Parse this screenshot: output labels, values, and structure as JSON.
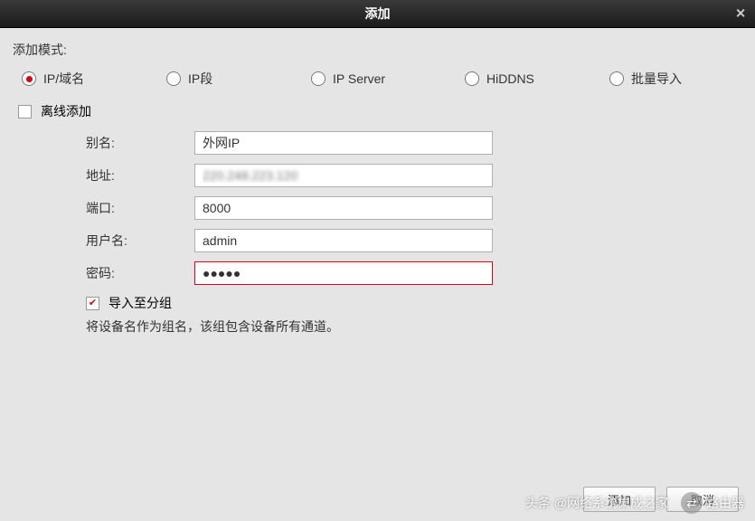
{
  "window": {
    "title": "添加"
  },
  "mode": {
    "label": "添加模式:",
    "options": [
      "IP/域名",
      "IP段",
      "IP Server",
      "HiDDNS",
      "批量导入"
    ],
    "selected": 0
  },
  "offline": {
    "label": "离线添加",
    "checked": false
  },
  "fields": {
    "alias": {
      "label": "别名:",
      "value": "外网IP"
    },
    "address": {
      "label": "地址:",
      "value": "220.248.223.120"
    },
    "port": {
      "label": "端口:",
      "value": "8000"
    },
    "user": {
      "label": "用户名:",
      "value": "admin"
    },
    "password": {
      "label": "密码:",
      "value": "●●●●●"
    }
  },
  "import_group": {
    "label": "导入至分组",
    "checked": true
  },
  "hint": "将设备名作为组名，该组包含设备所有通道。",
  "buttons": {
    "add": "添加",
    "cancel": "取消"
  },
  "watermark": {
    "left": "头条 @网络系统集成之家",
    "right": "路由器"
  }
}
